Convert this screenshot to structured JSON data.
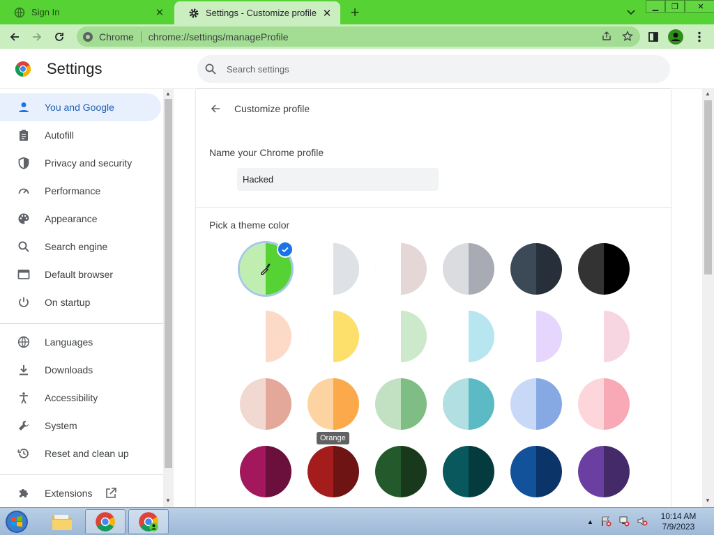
{
  "tabs": [
    {
      "title": "Sign In",
      "active": false
    },
    {
      "title": "Settings - Customize profile",
      "active": true
    }
  ],
  "omnibox": {
    "site_label": "Chrome",
    "url": "chrome://settings/manageProfile"
  },
  "header": {
    "title": "Settings",
    "search_placeholder": "Search settings"
  },
  "sidebar": {
    "items": [
      {
        "label": "You and Google",
        "icon": "person-icon",
        "active": true
      },
      {
        "label": "Autofill",
        "icon": "clipboard-icon"
      },
      {
        "label": "Privacy and security",
        "icon": "shield-icon"
      },
      {
        "label": "Performance",
        "icon": "speedometer-icon"
      },
      {
        "label": "Appearance",
        "icon": "palette-icon"
      },
      {
        "label": "Search engine",
        "icon": "search-icon"
      },
      {
        "label": "Default browser",
        "icon": "browser-window-icon"
      },
      {
        "label": "On startup",
        "icon": "power-icon"
      },
      {
        "label": "Languages",
        "icon": "globe-icon"
      },
      {
        "label": "Downloads",
        "icon": "download-icon"
      },
      {
        "label": "Accessibility",
        "icon": "accessibility-icon"
      },
      {
        "label": "System",
        "icon": "wrench-icon"
      },
      {
        "label": "Reset and clean up",
        "icon": "restore-icon"
      },
      {
        "label": "Extensions",
        "icon": "puzzle-icon"
      }
    ]
  },
  "main": {
    "subtitle": "Customize profile",
    "name_label": "Name your Chrome profile",
    "profile_name": "Hacked",
    "theme_label": "Pick a theme color",
    "tooltip": "Orange",
    "swatches": [
      {
        "left": "#bfeeb0",
        "right": "#56d235",
        "selected": true,
        "custom": true
      },
      {
        "left": "#ffffff",
        "right": "#dee1e6"
      },
      {
        "left": "#ffffff",
        "right": "#e6d7d7"
      },
      {
        "left": "#dadce0",
        "right": "#a8abb3"
      },
      {
        "left": "#3c4a57",
        "right": "#27303a"
      },
      {
        "left": "#333333",
        "right": "#000000"
      },
      {
        "left": "#ffffff",
        "right": "#fddac8"
      },
      {
        "left": "#ffffff",
        "right": "#fde06b"
      },
      {
        "left": "#ffffff",
        "right": "#cde9cb"
      },
      {
        "left": "#ffffff",
        "right": "#b7e5f0"
      },
      {
        "left": "#ffffff",
        "right": "#e6d6fd"
      },
      {
        "left": "#ffffff",
        "right": "#f7d6e2"
      },
      {
        "left": "#f1d9d2",
        "right": "#e3a89a"
      },
      {
        "left": "#fdd3a1",
        "right": "#fba94b"
      },
      {
        "left": "#c2e1c3",
        "right": "#7ebd83"
      },
      {
        "left": "#b2dfe1",
        "right": "#5bbac3"
      },
      {
        "left": "#c8d8f7",
        "right": "#86a9e4"
      },
      {
        "left": "#fdd6dc",
        "right": "#f9a8b5"
      },
      {
        "left": "#a3175c",
        "right": "#6b0f3d"
      },
      {
        "left": "#a41c1c",
        "right": "#6e1414"
      },
      {
        "left": "#245a2b",
        "right": "#19391c"
      },
      {
        "left": "#08585e",
        "right": "#053a3e"
      },
      {
        "left": "#11529b",
        "right": "#0b3468"
      },
      {
        "left": "#6a3fa1",
        "right": "#452a6a"
      }
    ]
  },
  "taskbar": {
    "time": "10:14 AM",
    "date": "7/9/2023"
  },
  "colors": {
    "frame": "#56d235",
    "toolbar": "#caeec0",
    "accent": "#1a73e8"
  }
}
